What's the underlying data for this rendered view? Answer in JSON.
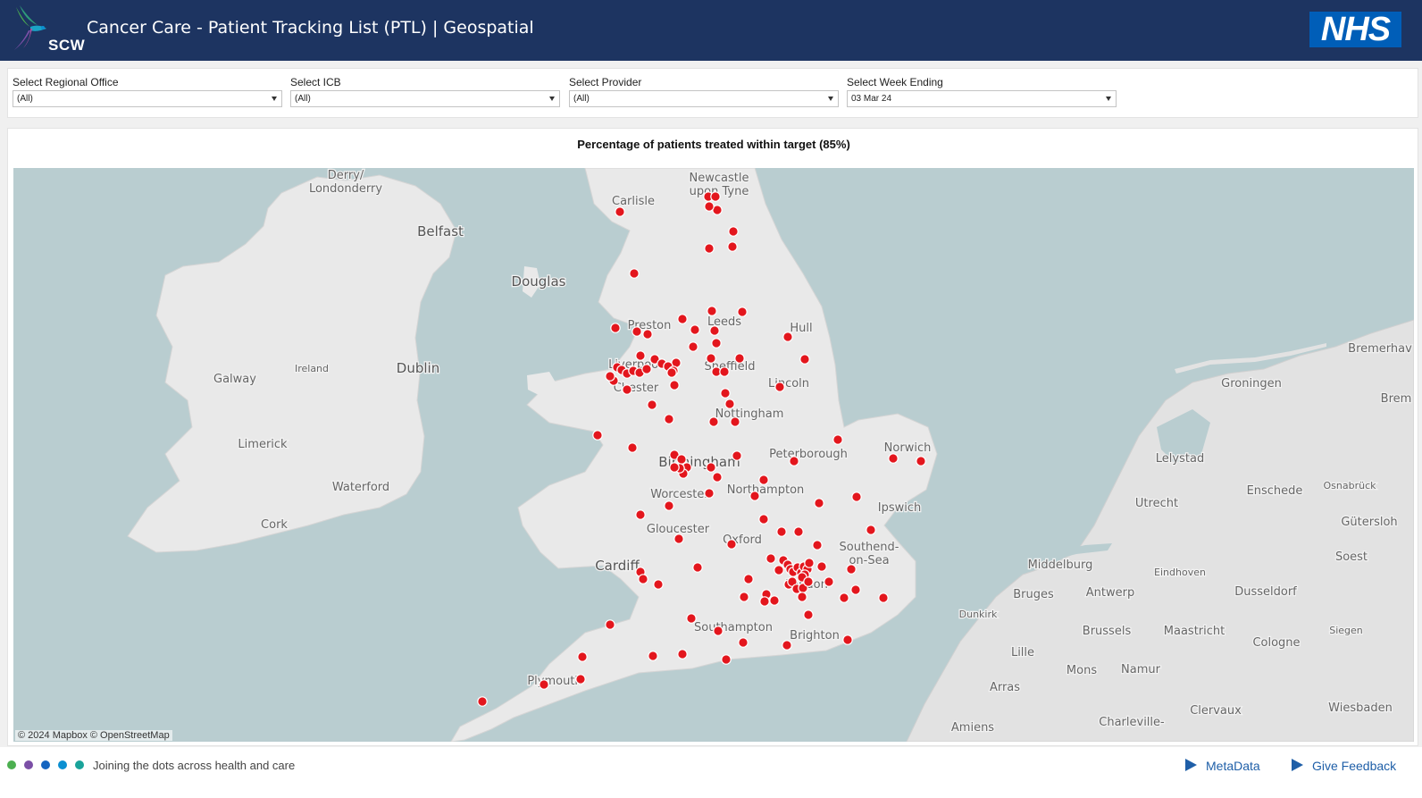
{
  "header": {
    "logo_text": "SCW",
    "title": "Cancer Care - Patient Tracking List (PTL) | Geospatial",
    "nhs_logo": "NHS",
    "colors": {
      "background": "#1d3461",
      "nhs_blue": "#005eb8"
    }
  },
  "filters": [
    {
      "label": "Select Regional Office",
      "value": "(All)"
    },
    {
      "label": "Select ICB",
      "value": "(All)"
    },
    {
      "label": "Select Provider",
      "value": "(All)"
    },
    {
      "label": "Select Week Ending",
      "value": "03 Mar 24"
    }
  ],
  "map": {
    "title": "Percentage of patients treated within target (85%)",
    "attribution": "© 2024 Mapbox © OpenStreetMap",
    "marker_color": "#e3161d",
    "water_color": "#b9cdd0",
    "land_color": "#e9e9e9",
    "places": [
      {
        "name": "Derry/",
        "line2": "Londonderry"
      },
      {
        "name": "Belfast"
      },
      {
        "name": "Douglas"
      },
      {
        "name": "Newcastle",
        "line2": "upon Tyne"
      },
      {
        "name": "Carlisle"
      },
      {
        "name": "Preston"
      },
      {
        "name": "Leeds"
      },
      {
        "name": "Hull"
      },
      {
        "name": "Liverpool"
      },
      {
        "name": "Sheffield"
      },
      {
        "name": "Chester"
      },
      {
        "name": "Lincoln"
      },
      {
        "name": "Nottingham"
      },
      {
        "name": "Dublin"
      },
      {
        "name": "Ireland"
      },
      {
        "name": "Galway"
      },
      {
        "name": "Limerick"
      },
      {
        "name": "Waterford"
      },
      {
        "name": "Cork"
      },
      {
        "name": "Norwich"
      },
      {
        "name": "Peterborough"
      },
      {
        "name": "Birmingham"
      },
      {
        "name": "Northampton"
      },
      {
        "name": "Worcester"
      },
      {
        "name": "Ipswich"
      },
      {
        "name": "Gloucester"
      },
      {
        "name": "Oxford"
      },
      {
        "name": "Southend-",
        "line2": "on-Sea"
      },
      {
        "name": "Cardiff"
      },
      {
        "name": "London"
      },
      {
        "name": "Southampton"
      },
      {
        "name": "Brighton"
      },
      {
        "name": "Plymouth"
      },
      {
        "name": "Groningen"
      },
      {
        "name": "Bremerhav"
      },
      {
        "name": "Brem"
      },
      {
        "name": "Lelystad"
      },
      {
        "name": "Utrecht"
      },
      {
        "name": "Enschede"
      },
      {
        "name": "Osnabrück"
      },
      {
        "name": "Gütersloh"
      },
      {
        "name": "Middelburg"
      },
      {
        "name": "Eindhoven"
      },
      {
        "name": "Soest"
      },
      {
        "name": "Bruges"
      },
      {
        "name": "Antwerp"
      },
      {
        "name": "Dusseldorf"
      },
      {
        "name": "Dunkirk"
      },
      {
        "name": "Brussels"
      },
      {
        "name": "Maastricht"
      },
      {
        "name": "Cologne"
      },
      {
        "name": "Siegen"
      },
      {
        "name": "Lille"
      },
      {
        "name": "Mons"
      },
      {
        "name": "Namur"
      },
      {
        "name": "Arras"
      },
      {
        "name": "Clervaux"
      },
      {
        "name": "Wiesbaden"
      },
      {
        "name": "Amiens"
      },
      {
        "name": "Charleville-"
      }
    ]
  },
  "footer": {
    "tagline": "Joining the dots across health and care",
    "dot_colors": [
      "#4caf50",
      "#7b4fa6",
      "#1565c0",
      "#0b8fd1",
      "#1aa39a"
    ],
    "links": {
      "metadata": "MetaData",
      "feedback": "Give Feedback"
    }
  }
}
